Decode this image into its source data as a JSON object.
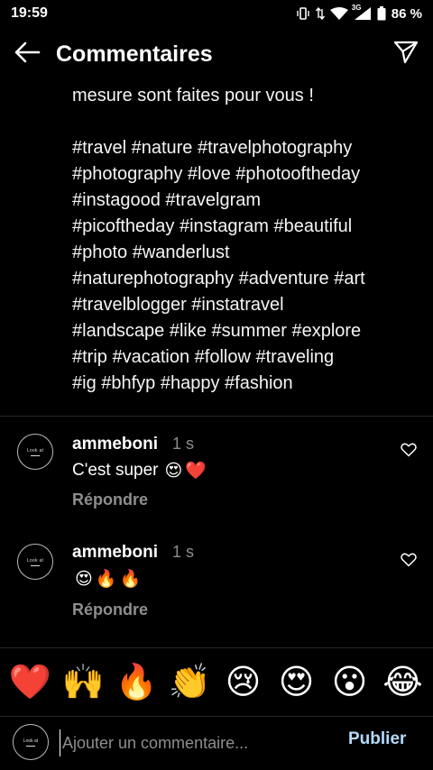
{
  "status": {
    "time": "19:59",
    "network": "3G",
    "battery": "86 %",
    "icons": [
      "vibrate-icon",
      "data-arrows-icon",
      "wifi-icon",
      "signal-icon",
      "battery-icon"
    ]
  },
  "header": {
    "title": "Commentaires",
    "back_icon": "arrow-left-icon",
    "send_icon": "paper-plane-icon"
  },
  "caption": {
    "first_line": "mesure sont faites pour vous !",
    "hashtags": "#travel #nature #travelphotography\n#photography #love #photooftheday\n#instagood #travelgram\n#picoftheday #instagram #beautiful\n#photo #wanderlust\n#naturephotography #adventure #art\n#travelblogger #instatravel\n#landscape #like #summer #explore\n#trip #vacation #follow #traveling\n#ig #bhfyp #happy #fashion"
  },
  "comments": [
    {
      "avatar_text": "Look at",
      "username": "ammeboni",
      "time": "1 s",
      "text": "C'est super",
      "emojis": [
        "😍",
        "❤️"
      ],
      "reply_label": "Répondre"
    },
    {
      "avatar_text": "Look at",
      "username": "ammeboni",
      "time": "1 s",
      "text": "",
      "emojis": [
        "😍",
        "🔥",
        "🔥"
      ],
      "reply_label": "Répondre"
    }
  ],
  "emoji_bar": [
    "❤️",
    "🙌",
    "🔥",
    "👏",
    "😢",
    "😍",
    "😮",
    "😂"
  ],
  "input": {
    "avatar_text": "Look at",
    "placeholder": "Ajouter un commentaire...",
    "publish_label": "Publier"
  },
  "colors": {
    "background": "#000000",
    "muted": "#8e8e8e",
    "publish": "#b3dbff",
    "divider": "#262626"
  }
}
